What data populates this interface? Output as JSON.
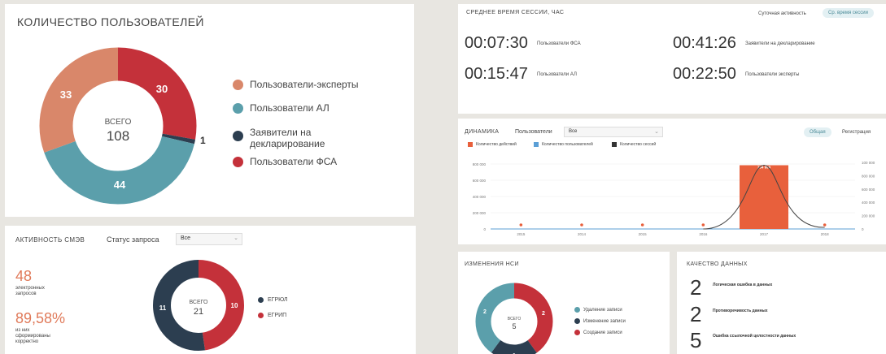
{
  "colors": {
    "experts": "#d9876a",
    "al": "#5b9fab",
    "declarants": "#2c3e50",
    "fsa": "#c4313a",
    "accent": "#e8603c",
    "area": "#5b9fd6"
  },
  "users": {
    "title": "КОЛИЧЕСТВО ПОЛЬЗОВАТЕЛЕЙ",
    "total_label": "ВСЕГО",
    "total": "108",
    "segments": [
      {
        "name": "Пользователи-эксперты",
        "value": 33,
        "color": "#d9876a"
      },
      {
        "name": "Пользователи АЛ",
        "value": 44,
        "color": "#5b9fab"
      },
      {
        "name": "Заявители на декларирование",
        "value": 1,
        "color": "#2c3e50"
      },
      {
        "name": "Пользователи ФСА",
        "value": 30,
        "color": "#c4313a"
      }
    ],
    "legend": [
      "Пользователи-эксперты",
      "Пользователи АЛ",
      "Заявители на",
      "декларирование",
      "Пользователи ФСА"
    ],
    "labels": {
      "experts": "33",
      "al": "44",
      "declarants": "1",
      "fsa": "30"
    }
  },
  "smev": {
    "title": "АКТИВНОСТЬ СМЭВ",
    "status_label": "Статус запроса",
    "select_value": "Все",
    "stat1_value": "48",
    "stat1_l1": "электронных",
    "stat1_l2": "запросов",
    "stat2_value": "89,58%",
    "stat2_l1": "из них",
    "stat2_l2": "сформированы",
    "stat2_l3": "корректно",
    "total_label": "ВСЕГО",
    "total": "21",
    "segments": [
      {
        "name": "ЕГРЮЛ",
        "value": 11,
        "color": "#2c3e50"
      },
      {
        "name": "ЕГРИП",
        "value": 10,
        "color": "#c4313a"
      }
    ],
    "labels": {
      "egrul": "11",
      "egrip": "10"
    }
  },
  "session": {
    "title": "СРЕДНЕЕ ВРЕМЯ СЕССИИ, ЧАС",
    "tab1": "Суточная активность",
    "tab2": "Ср. время сессии",
    "items": [
      {
        "time": "00:07:30",
        "label": "Пользователи ФСА"
      },
      {
        "time": "00:41:26",
        "label": "Заявители на декларирование"
      },
      {
        "time": "00:15:47",
        "label": "Пользователи АЛ"
      },
      {
        "time": "00:22:50",
        "label": "Пользователи эксперты"
      }
    ]
  },
  "dynamics": {
    "title": "ДИНАМИКА",
    "filter_label": "Пользователи",
    "select_value": "Все",
    "tab1": "Общая",
    "tab2": "Регистрация",
    "legend": [
      "Количество действий",
      "Количество пользователей",
      "Количество сессий"
    ],
    "bar_label": "784 999"
  },
  "chart_data": {
    "type": "bar",
    "categories": [
      "2015",
      "2014",
      "2015",
      "2016",
      "2017",
      "2018"
    ],
    "series": [
      {
        "name": "Количество действий",
        "values": [
          0,
          0,
          0,
          0,
          784999,
          0
        ]
      },
      {
        "name": "Количество сессий",
        "values": [
          0,
          0,
          0,
          0,
          784999,
          0
        ]
      }
    ],
    "ylim": [
      0,
      800000
    ],
    "y_ticks": [
      "0",
      "200 000",
      "400 000",
      "600 000",
      "800 000"
    ],
    "y2_ticks": [
      "0",
      "200 000",
      "400 000",
      "600 000",
      "800 000",
      "100 000"
    ]
  },
  "nsi": {
    "title": "ИЗМЕНЕНИЯ НСИ",
    "total_label": "ВСЕГО",
    "total": "5",
    "segments": [
      {
        "name": "Удаление записи",
        "value": 2,
        "color": "#5b9fab"
      },
      {
        "name": "Изменение записи",
        "value": 1,
        "color": "#2c3e50"
      },
      {
        "name": "Создание записи",
        "value": 2,
        "color": "#c4313a"
      }
    ],
    "labels": {
      "del": "2",
      "chg": "1",
      "add": "2"
    }
  },
  "quality": {
    "title": "КАЧЕСТВО ДАННЫХ",
    "items": [
      {
        "value": "2",
        "label": "Логическая ошибка в данных"
      },
      {
        "value": "2",
        "label": "Противоречивость данных"
      },
      {
        "value": "5",
        "label": "Ошибка ссылочной целостности данных"
      }
    ]
  }
}
